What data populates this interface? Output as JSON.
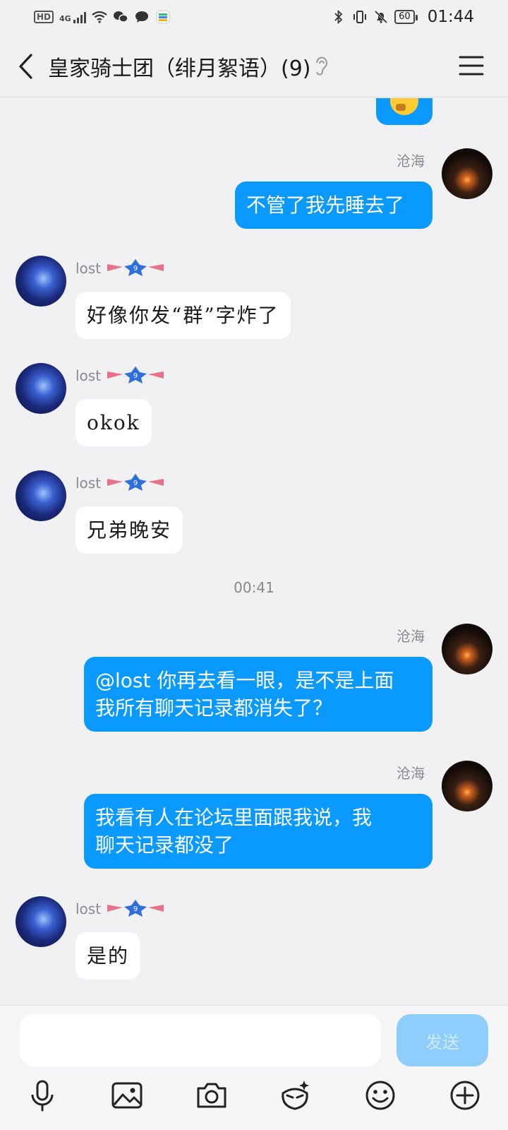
{
  "status_bar": {
    "hd": "HD",
    "net": "4G",
    "battery": "60",
    "time": "01:44"
  },
  "header": {
    "title": "皇家骑士团（绯月絮语）(9)"
  },
  "messages": [
    {
      "type": "out-partial",
      "content": "emoji-thinking"
    },
    {
      "type": "out",
      "sender": "沧海",
      "text": "不管了我先睡去了"
    },
    {
      "type": "in",
      "sender": "lost",
      "text": "好像你发“群”字炸了"
    },
    {
      "type": "in",
      "sender": "lost",
      "text": "okok"
    },
    {
      "type": "in",
      "sender": "lost",
      "text": "兄弟晚安"
    },
    {
      "type": "time",
      "text": "00:41"
    },
    {
      "type": "out",
      "sender": "沧海",
      "lines": [
        "@lost 你再去看一眼，是不是上面",
        "我所有聊天记录都消失了？"
      ]
    },
    {
      "type": "out",
      "sender": "沧海",
      "lines": [
        "我看有人在论坛里面跟我说，我",
        "聊天记录都没了"
      ]
    },
    {
      "type": "in",
      "sender": "lost",
      "text": "是的"
    }
  ],
  "input": {
    "placeholder": "",
    "send_label": "发送"
  },
  "toolbar": [
    "microphone-icon",
    "image-icon",
    "camera-icon",
    "sticker-icon",
    "emoji-icon",
    "plus-icon"
  ],
  "colors": {
    "outgoing_bubble": "#0a99ff",
    "incoming_bubble": "#ffffff",
    "send_disabled": "#8fcdfa",
    "background": "#f1f1f3"
  }
}
